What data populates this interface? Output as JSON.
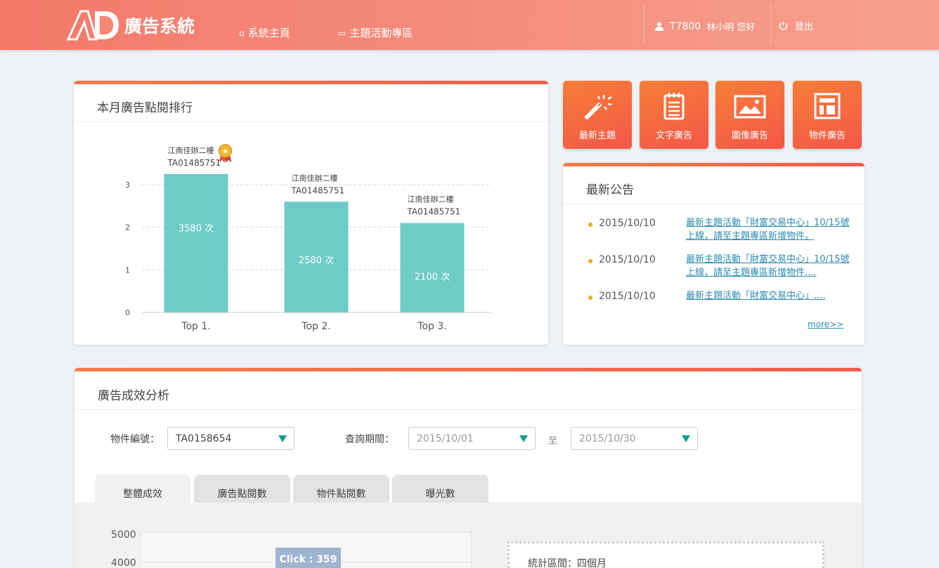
{
  "header": {
    "logo_text": "廣告系統",
    "nav": [
      {
        "label": "系統主頁",
        "icon": "home-icon"
      },
      {
        "label": "主題活動專區",
        "icon": "window-icon"
      }
    ],
    "user_id": "T7800",
    "user_greeting": "林小明 您好",
    "logout_label": "登出"
  },
  "ranking": {
    "title": "本月廣告點閱排行"
  },
  "chart_data": {
    "type": "bar",
    "categories": [
      "Top 1.",
      "Top 2.",
      "Top 3."
    ],
    "values": [
      3.25,
      2.6,
      2.1
    ],
    "value_labels": [
      "3580 次",
      "2580 次",
      "2100 次"
    ],
    "bar_names": [
      "江南佳辦二樓",
      "江南佳辦二樓",
      "江南佳辦二樓"
    ],
    "bar_ids": [
      "TA01485751",
      "TA01485751",
      "TA01485751"
    ],
    "yticks": [
      "3",
      "2",
      "1",
      "0"
    ],
    "ylim": [
      0,
      3.4
    ],
    "grid": true,
    "bar_color": "#6dcbc8"
  },
  "quick_buttons": [
    {
      "label": "最新主題",
      "icon": "magic-wand-icon"
    },
    {
      "label": "文字廣告",
      "icon": "notepad-icon"
    },
    {
      "label": "圖像廣告",
      "icon": "image-icon"
    },
    {
      "label": "物件廣告",
      "icon": "layout-icon"
    }
  ],
  "announcements": {
    "title": "最新公告",
    "items": [
      {
        "date": "2015/10/10",
        "text": "最新主題活動「財富交易中心」10/15號上線，請至主題專區新增物件。"
      },
      {
        "date": "2015/10/10",
        "text": "最新主題活動「財富交易中心」10/15號上線，請至主題專區新增物件...."
      },
      {
        "date": "2015/10/10",
        "text": "最新主題活動「財富交易中心」...."
      }
    ],
    "more_label": "more>>"
  },
  "analysis": {
    "title": "廣告成效分析",
    "item_label": "物件編號：",
    "item_value": "TA0158654",
    "period_label": "查詢期間：",
    "date_from": "2015/10/01",
    "to_label": "至",
    "date_to": "2015/10/30",
    "tabs": [
      "整體成效",
      "廣告點閱數",
      "物件點閱數",
      "曝光數"
    ],
    "active_tab": 0,
    "yticks": [
      "5000",
      "4000"
    ],
    "tooltip": "Click : 359",
    "stat_label": "統計區間：四個月"
  },
  "colors": {
    "header_start": "#f3796a",
    "header_end": "#f6a08f",
    "accent": "#f25c4c",
    "bar": "#6dcbc8",
    "link": "#2a8bb0",
    "bullet": "#f5a623"
  }
}
